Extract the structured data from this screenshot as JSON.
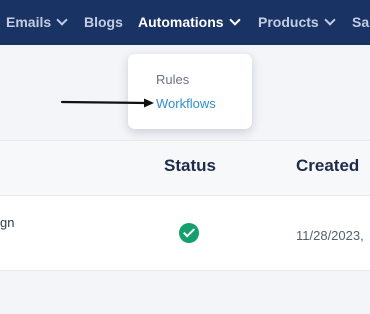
{
  "nav": {
    "items": [
      {
        "label": "Emails",
        "has_chevron": true,
        "active": false
      },
      {
        "label": "Blogs",
        "has_chevron": false,
        "active": false
      },
      {
        "label": "Automations",
        "has_chevron": true,
        "active": true
      },
      {
        "label": "Products",
        "has_chevron": true,
        "active": false
      },
      {
        "label": "Sa",
        "has_chevron": false,
        "active": false
      }
    ]
  },
  "dropdown": {
    "items": [
      {
        "label": "Rules"
      },
      {
        "label": "Workflows"
      }
    ]
  },
  "table": {
    "headers": {
      "status": "Status",
      "created": "Created"
    },
    "rows": [
      {
        "name_fragment": "gn",
        "status_icon": "check-circle-icon",
        "created": "11/28/2023,"
      }
    ]
  },
  "colors": {
    "nav_bg": "#1a3365",
    "status_green": "#12a06e",
    "link_blue": "#2f8fd0"
  }
}
